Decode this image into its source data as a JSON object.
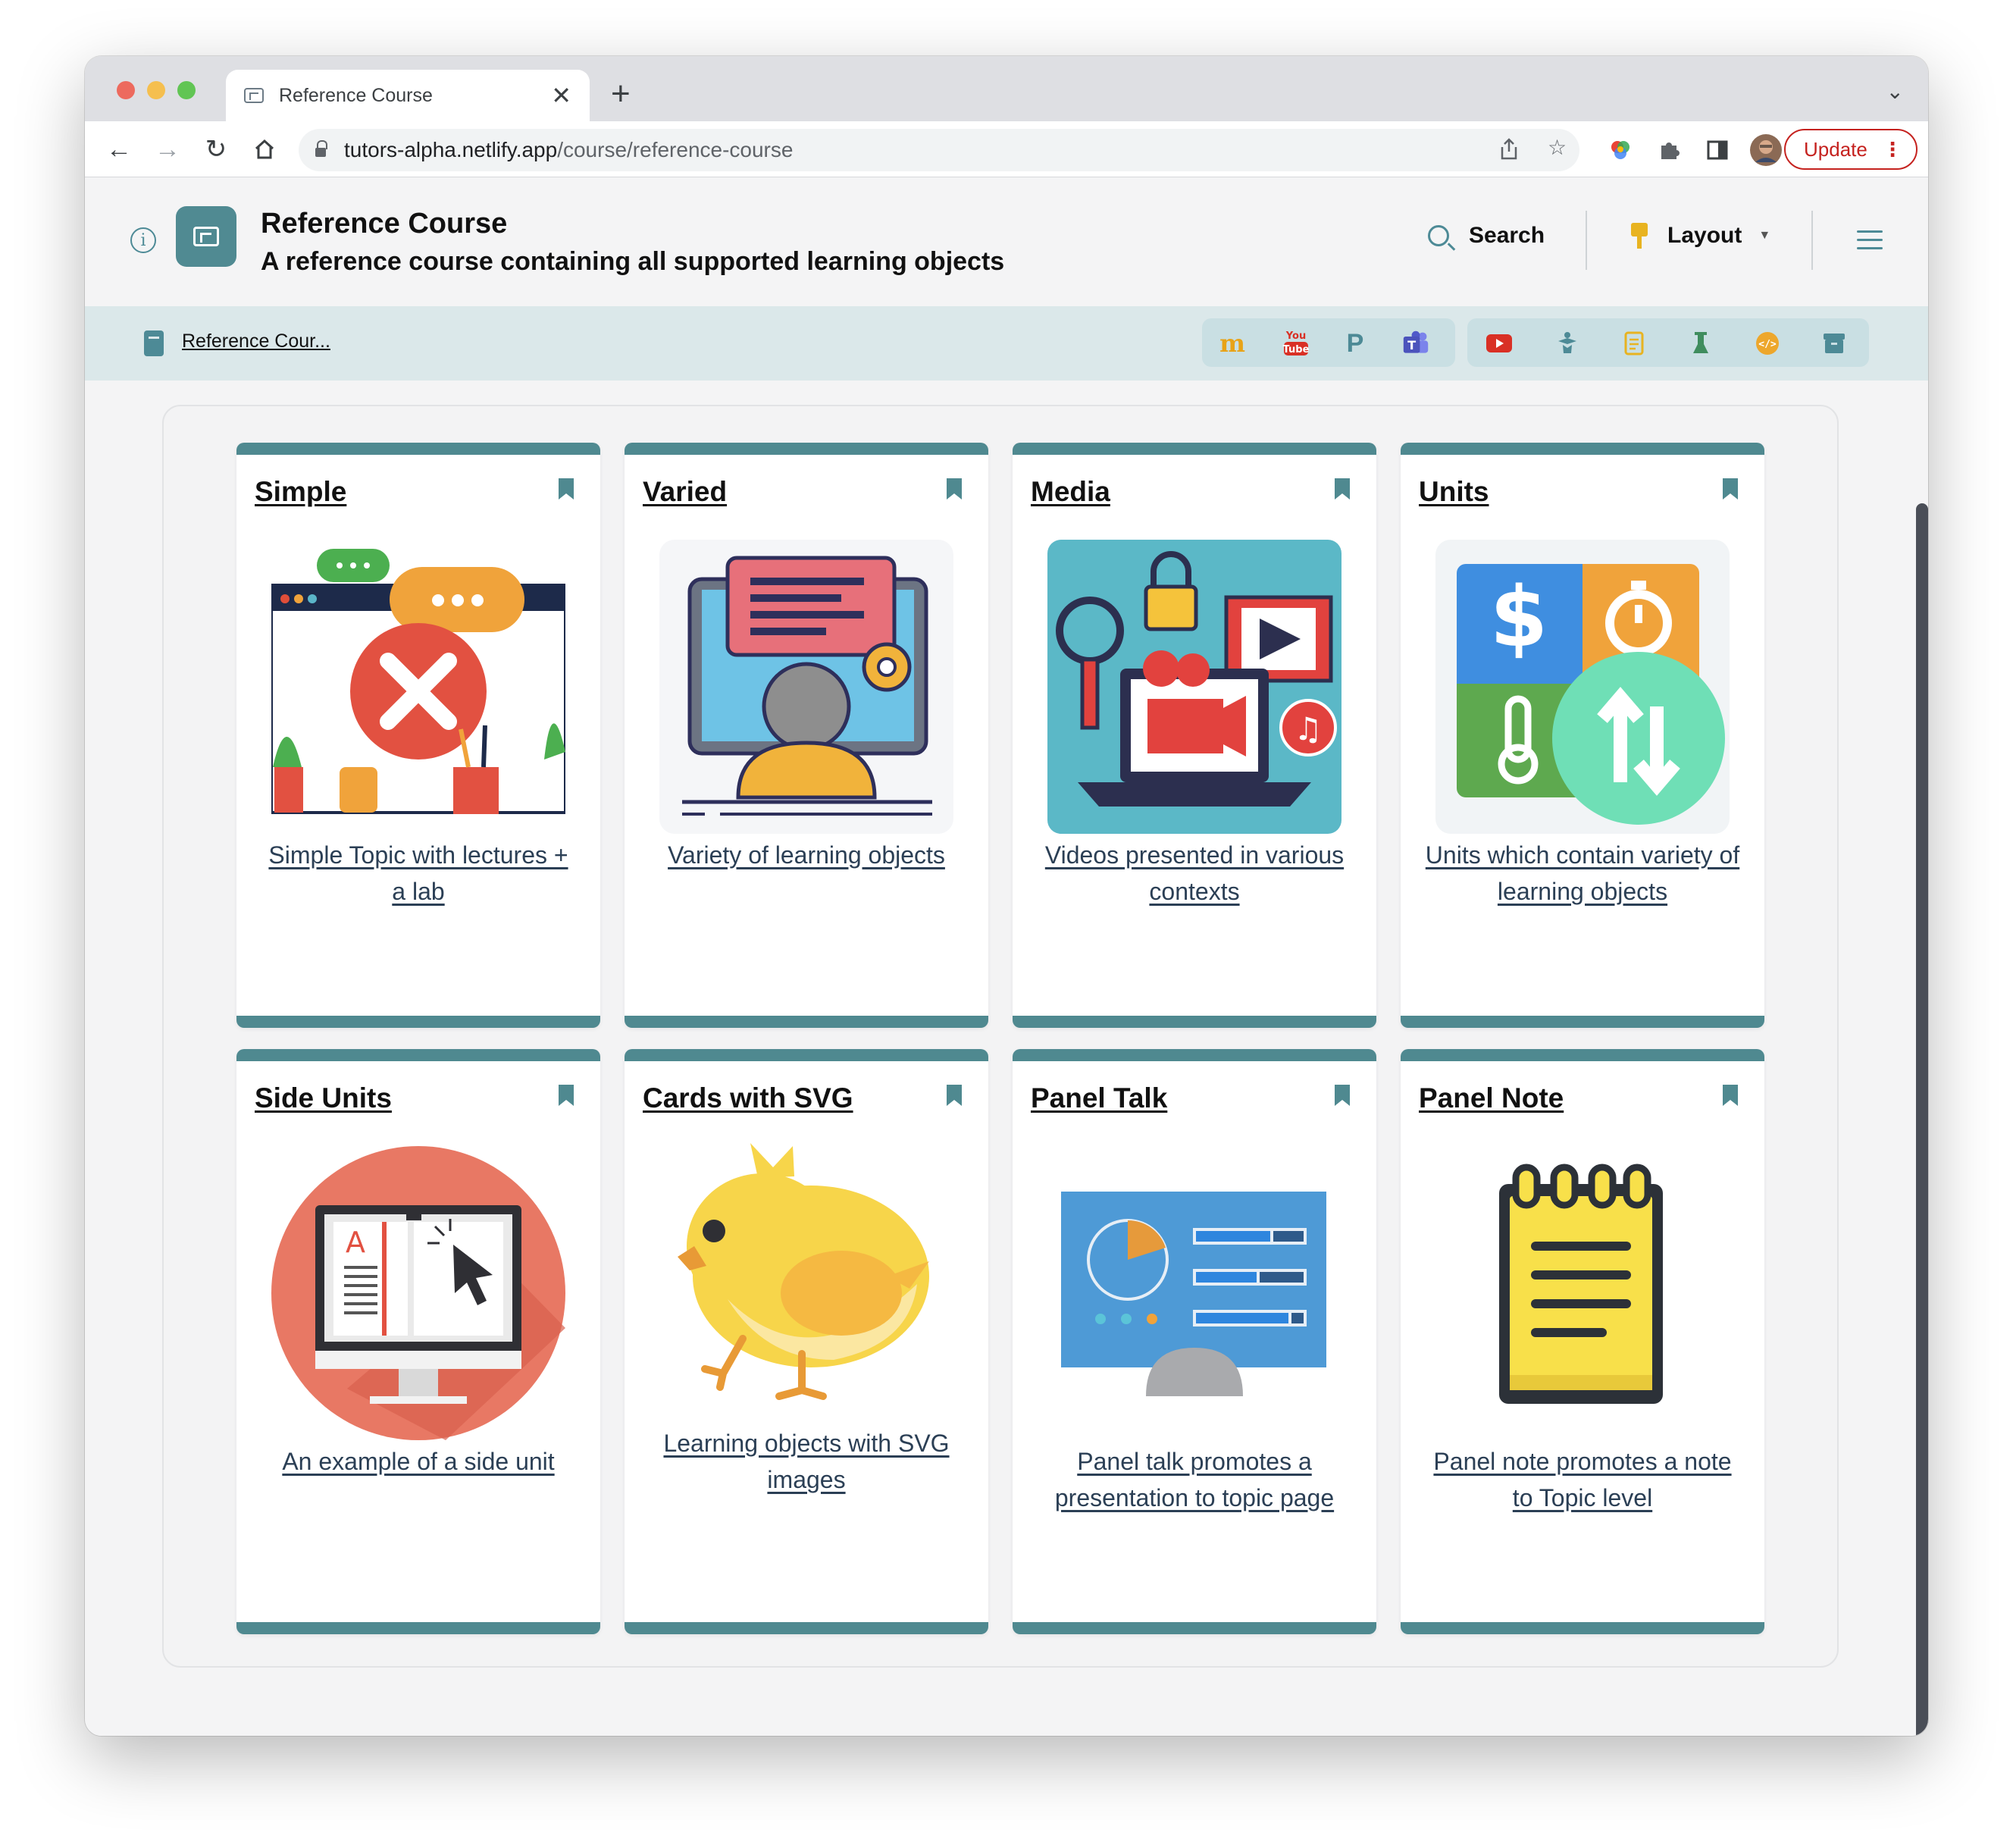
{
  "browser": {
    "tab_title": "Reference Course",
    "new_tab_label": "+",
    "url_host": "tutors-alpha.netlify.app",
    "url_path": "/course/reference-course",
    "update_label": "Update"
  },
  "header": {
    "title": "Reference Course",
    "subtitle": "A reference course containing all supported learning objects",
    "search_label": "Search",
    "layout_label": "Layout"
  },
  "breadcrumb": {
    "label": "Reference Cour..."
  },
  "toolbar_icons": {
    "group1": [
      "moodle-icon",
      "youtube-icon",
      "piazza-icon",
      "teams-icon"
    ],
    "group2": [
      "video-icon",
      "labs-icon",
      "notes-icon",
      "archive-icon-flask",
      "code-icon",
      "archive-icon"
    ],
    "youtube_text": "You Tube"
  },
  "colors": {
    "accent": "#4f8990",
    "breadcrumb_bg": "#dbe8ea",
    "update_red": "#c5221f"
  },
  "cards": [
    {
      "title": "Simple",
      "summary": "Simple Topic with lectures + a lab",
      "image": "chat-error-illustration"
    },
    {
      "title": "Varied",
      "summary": "Variety of learning objects",
      "image": "monitor-user-illustration"
    },
    {
      "title": "Media",
      "summary": "Videos presented in various contexts",
      "image": "media-laptop-illustration"
    },
    {
      "title": "Units",
      "summary": "Units which contain variety of learning objects",
      "image": "units-conversion-illustration"
    },
    {
      "title": "Side Units",
      "summary": "An example of a side unit",
      "image": "ebook-monitor-illustration"
    },
    {
      "title": "Cards with SVG",
      "summary": "Learning objects with SVG images",
      "image": "yellow-bird-illustration"
    },
    {
      "title": "Panel Talk",
      "summary": "Panel talk promotes a presentation to topic page",
      "image": "presentation-board-illustration"
    },
    {
      "title": "Panel Note",
      "summary": "Panel note promotes a note to Topic level",
      "image": "notepad-illustration"
    }
  ]
}
